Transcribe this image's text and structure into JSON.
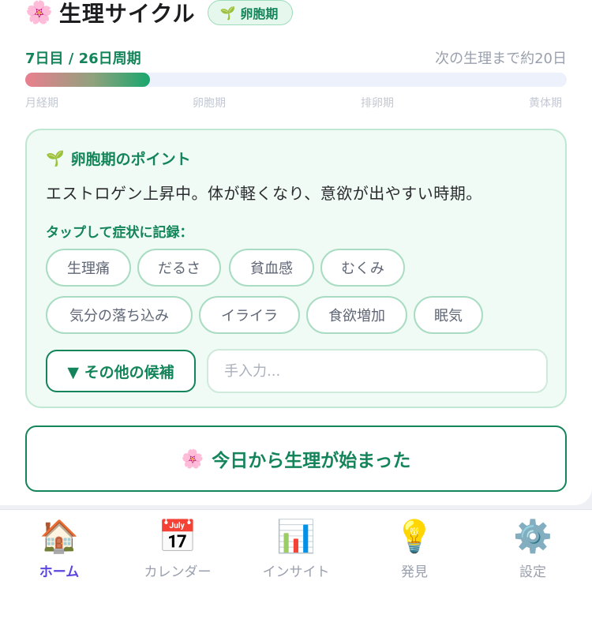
{
  "header": {
    "emoji": "🌸",
    "title": "生理サイクル",
    "phase_badge": {
      "icon": "🌱",
      "label": "卵胞期"
    }
  },
  "cycle": {
    "day_text": "7日目 / 26日周期",
    "next_period_text": "次の生理まで約20日",
    "progress_fraction": 0.23,
    "phases": [
      "月経期",
      "卵胞期",
      "排卵期",
      "黄体期"
    ]
  },
  "info": {
    "heading_icon": "🌱",
    "heading": "卵胞期のポイント",
    "description": "エストロゲン上昇中。体が軽くなり、意欲が出やすい時期。",
    "tap_prompt": "タップして症状に記録：",
    "symptoms": [
      "生理痛",
      "だるさ",
      "貧血感",
      "むくみ",
      "気分の落ち込み",
      "イライラ",
      "食欲増加",
      "眠気"
    ],
    "more_button": "▼ その他の候補",
    "input_placeholder": "手入力..."
  },
  "start_button": {
    "emoji": "🌸",
    "label": "今日から生理が始まった"
  },
  "tabs": [
    {
      "icon": "🏠",
      "label": "ホーム",
      "active": true
    },
    {
      "icon": "📅",
      "label": "カレンダー",
      "active": false
    },
    {
      "icon": "📊",
      "label": "インサイト",
      "active": false
    },
    {
      "icon": "💡",
      "label": "発見",
      "active": false
    },
    {
      "icon": "⚙️",
      "label": "設定",
      "active": false
    }
  ],
  "colors": {
    "accent_green": "#14855a",
    "active_tab": "#5b47e0",
    "progress_start": "#ea7f8e",
    "progress_end": "#18a66d"
  }
}
